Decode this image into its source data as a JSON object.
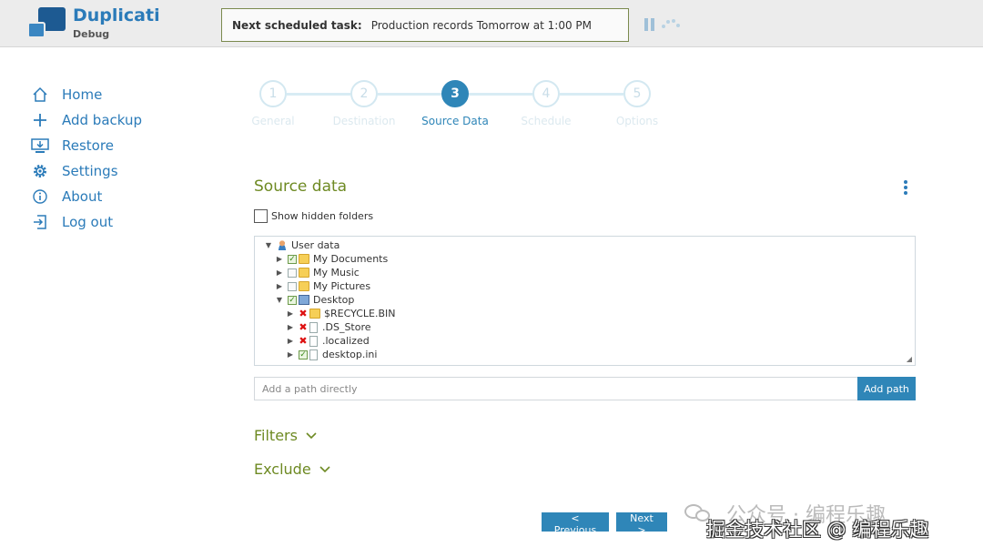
{
  "header": {
    "app_name": "Duplicati",
    "app_subtitle": "Debug",
    "task_label": "Next scheduled task:",
    "task_value": "Production records Tomorrow at 1:00 PM"
  },
  "sidebar": {
    "items": [
      {
        "label": "Home",
        "icon": "home-icon"
      },
      {
        "label": "Add backup",
        "icon": "plus-icon"
      },
      {
        "label": "Restore",
        "icon": "restore-icon"
      },
      {
        "label": "Settings",
        "icon": "gear-icon"
      },
      {
        "label": "About",
        "icon": "info-icon"
      },
      {
        "label": "Log out",
        "icon": "logout-icon"
      }
    ]
  },
  "steps": [
    {
      "number": "1",
      "label": "General"
    },
    {
      "number": "2",
      "label": "Destination"
    },
    {
      "number": "3",
      "label": "Source Data",
      "active": true
    },
    {
      "number": "4",
      "label": "Schedule"
    },
    {
      "number": "5",
      "label": "Options"
    }
  ],
  "source": {
    "title": "Source data",
    "show_hidden_label": "Show hidden folders",
    "show_hidden_checked": false,
    "tree": [
      {
        "label": "User data",
        "depth": 0,
        "expanded": true,
        "state": "none",
        "icon": "user-icon"
      },
      {
        "label": "My Documents",
        "depth": 1,
        "expanded": false,
        "state": "checked",
        "icon": "folder-icon"
      },
      {
        "label": "My Music",
        "depth": 1,
        "expanded": false,
        "state": "empty",
        "icon": "folder-icon"
      },
      {
        "label": "My Pictures",
        "depth": 1,
        "expanded": false,
        "state": "empty",
        "icon": "folder-icon"
      },
      {
        "label": "Desktop",
        "depth": 1,
        "expanded": true,
        "state": "checked",
        "icon": "desktop-icon"
      },
      {
        "label": "$RECYCLE.BIN",
        "depth": 2,
        "expanded": false,
        "state": "excluded",
        "icon": "folder-icon"
      },
      {
        "label": ".DS_Store",
        "depth": 2,
        "expanded": false,
        "state": "excluded",
        "icon": "file-icon"
      },
      {
        "label": ".localized",
        "depth": 2,
        "expanded": false,
        "state": "excluded",
        "icon": "file-icon"
      },
      {
        "label": "desktop.ini",
        "depth": 2,
        "expanded": false,
        "state": "checked",
        "icon": "file-icon"
      }
    ],
    "path_placeholder": "Add a path directly",
    "add_path_label": "Add path"
  },
  "filters_label": "Filters",
  "exclude_label": "Exclude",
  "buttons": {
    "previous": "< Previous",
    "next": "Next >"
  },
  "watermark": {
    "top": "公众号 · 编程乐趣",
    "bottom": "掘金技术社区 @ 编程乐趣"
  },
  "colors": {
    "accent_blue": "#2f86b8",
    "title_green": "#6e8a23",
    "link_blue": "#2b7bb9"
  }
}
